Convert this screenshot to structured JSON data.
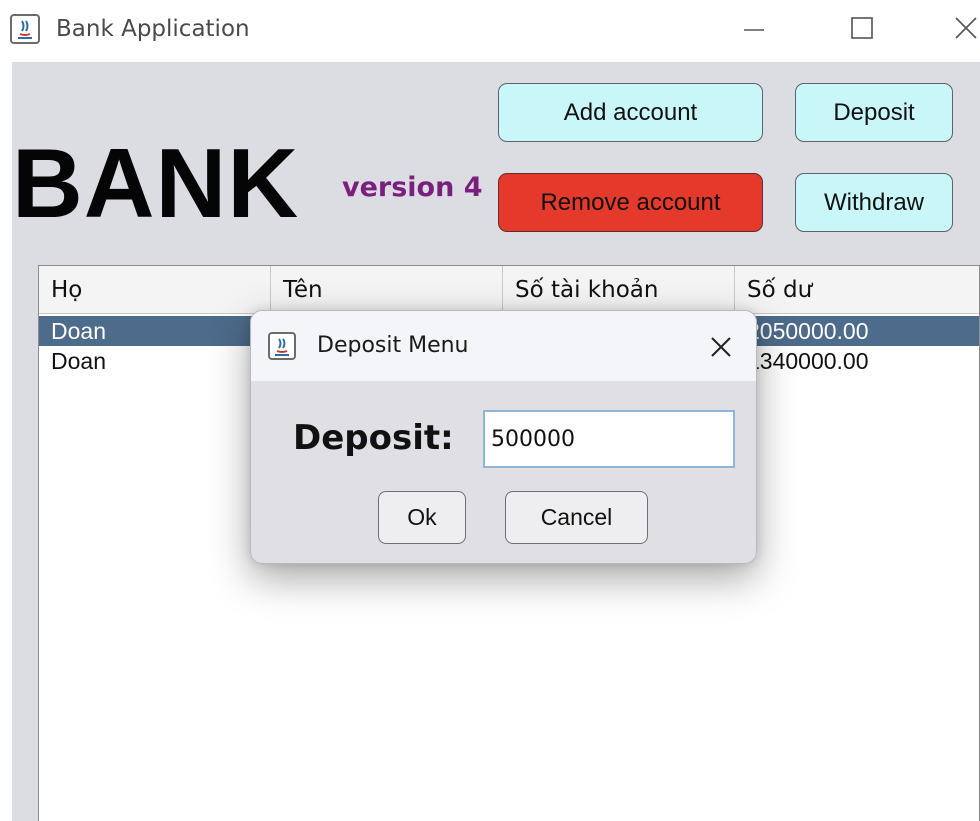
{
  "window": {
    "title": "Bank Application",
    "controls": [
      "minimize-icon",
      "maximize-icon",
      "close-icon"
    ]
  },
  "header": {
    "logo": "BANK",
    "version": "version 4"
  },
  "buttons": {
    "add_account": "Add account",
    "remove_account": "Remove account",
    "deposit": "Deposit",
    "withdraw": "Withdraw"
  },
  "table": {
    "columns": [
      "Họ",
      "Tên",
      "Số tài khoản",
      "Số dư"
    ],
    "rows": [
      {
        "ho": "Doan",
        "ten": "",
        "so_tai_khoan": "",
        "so_du": "2050000.00",
        "selected": true
      },
      {
        "ho": "Doan",
        "ten": "",
        "so_tai_khoan": "",
        "so_du": "1340000.00",
        "selected": false
      }
    ]
  },
  "dialog": {
    "title": "Deposit Menu",
    "label": "Deposit:",
    "input_value": "500000",
    "ok": "Ok",
    "cancel": "Cancel"
  },
  "colors": {
    "accent_cyan": "#c9f7f9",
    "danger_red": "#e53a2b",
    "version_purple": "#7a1f7e",
    "selected_row": "#4d6b8a",
    "panel_bg": "#dcdde2"
  }
}
